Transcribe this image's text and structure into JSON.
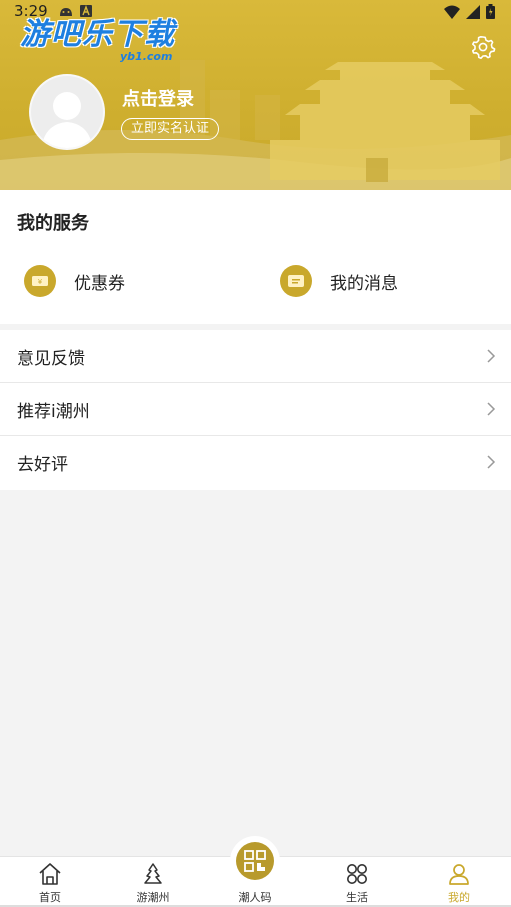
{
  "status_bar": {
    "time": "3:29"
  },
  "watermark": {
    "main": "游吧乐下载",
    "sub": "yb1.com"
  },
  "profile": {
    "login_label": "点击登录",
    "verify_label": "立即实名认证"
  },
  "services": {
    "title": "我的服务",
    "items": [
      {
        "label": "优惠券",
        "icon": "coupon-icon"
      },
      {
        "label": "我的消息",
        "icon": "message-icon"
      }
    ]
  },
  "menu": [
    {
      "label": "意见反馈"
    },
    {
      "label": "推荐i潮州"
    },
    {
      "label": "去好评"
    }
  ],
  "bottom_nav": [
    {
      "label": "首页",
      "icon": "home-icon"
    },
    {
      "label": "游潮州",
      "icon": "travel-icon"
    },
    {
      "label": "潮人码",
      "icon": "qr-code-icon"
    },
    {
      "label": "生活",
      "icon": "grid-icon"
    },
    {
      "label": "我的",
      "icon": "user-icon",
      "active": true
    }
  ],
  "colors": {
    "brand_gold": "#c9a82c",
    "header_bg": "#d9b93a",
    "watermark_blue": "#1e7fe0"
  }
}
